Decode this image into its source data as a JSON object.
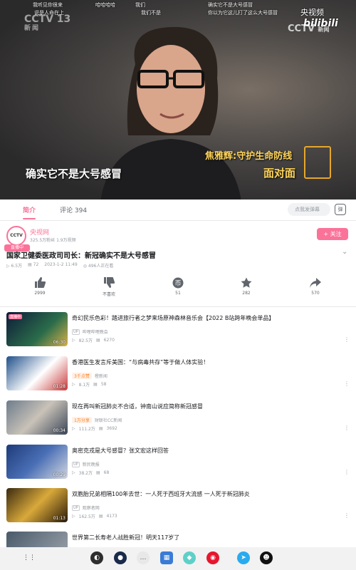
{
  "player": {
    "danmaku": [
      "我听见你很来",
      "说是人命在上",
      "我们",
      "哈哈哈哈",
      "我们不是",
      "确实它不是大号感冒",
      "你以为它这儿打了这么大号感冒"
    ],
    "subtitle": "确实它不是大号感冒",
    "caption_name": "焦雅辉:守护生命防线",
    "caption_show": "面对面",
    "watermark_left": "CCTV 13",
    "watermark_left_sub": "新闻",
    "watermark_right": "CCTV",
    "watermark_right_sub": "新闻",
    "bili_channel": "央视频",
    "bili_logo": "bilibili"
  },
  "tabs": {
    "intro": "简介",
    "comments": "评论 394",
    "danmaku_placeholder": "点我发弹幕",
    "danmaku_toggle": "弹"
  },
  "uploader": {
    "avatar": "CCTV",
    "live_tag": "直播中",
    "name": "央视网",
    "stats": "325.5万粉丝  1.9万视频",
    "follow": "+ 关注"
  },
  "video": {
    "title": "国家卫健委医政司司长：新冠确实不是大号感冒",
    "views": "6.5万",
    "danmaku_count": "72",
    "date": "2023-1-2 11:49",
    "watching": "496人正在看"
  },
  "actions": [
    {
      "icon": "thumbs-up-icon",
      "label": "2999"
    },
    {
      "icon": "thumbs-down-icon",
      "label": "不喜欢"
    },
    {
      "icon": "coin-icon",
      "label": "51"
    },
    {
      "icon": "star-icon",
      "label": "282"
    },
    {
      "icon": "share-icon",
      "label": "570"
    }
  ],
  "related": [
    {
      "title": "奇幻民乐色彩！踏进旅行者之梦来场原神森林音乐会【2022 B站跨年晚会单品】",
      "duration": "06:30",
      "badge": "",
      "uploader": "哔哩哔哩晚会",
      "views": "82.5万",
      "danmaku": "6270",
      "live": "直播中"
    },
    {
      "title": "香港医生发言斥美国：“与病毒共存”等于做人体实验！",
      "duration": "01:28",
      "badge": "3千点赞",
      "uploader": "橙新闻",
      "views": "8.1万",
      "danmaku": "58",
      "live": ""
    },
    {
      "title": "现在再叫新冠肺炎不合适，钟南山说应简称新冠感冒",
      "duration": "00:34",
      "badge": "1万分享",
      "uploader": "财联社CC新闻",
      "views": "111.2万",
      "danmaku": "3692",
      "live": ""
    },
    {
      "title": "奥密克戎是大号感冒？张文宏这样回答",
      "duration": "00:29",
      "badge": "",
      "uploader": "新民晚报",
      "views": "38.2万",
      "danmaku": "68",
      "live": ""
    },
    {
      "title": "双胞胎兄弟相隔100年去世：一人死于西班牙大流感 一人死于新冠肺炎",
      "duration": "01:13",
      "badge": "",
      "uploader": "观察者网",
      "views": "162.5万",
      "danmaku": "4173",
      "live": ""
    },
    {
      "title": "世界第二长寿老人战胜新冠！明天117岁了",
      "duration": "",
      "badge": "",
      "uploader": "",
      "views": "",
      "danmaku": "",
      "live": ""
    }
  ],
  "colors": {
    "accent": "#fb7299",
    "text": "#18191c",
    "muted": "#9499a0"
  }
}
